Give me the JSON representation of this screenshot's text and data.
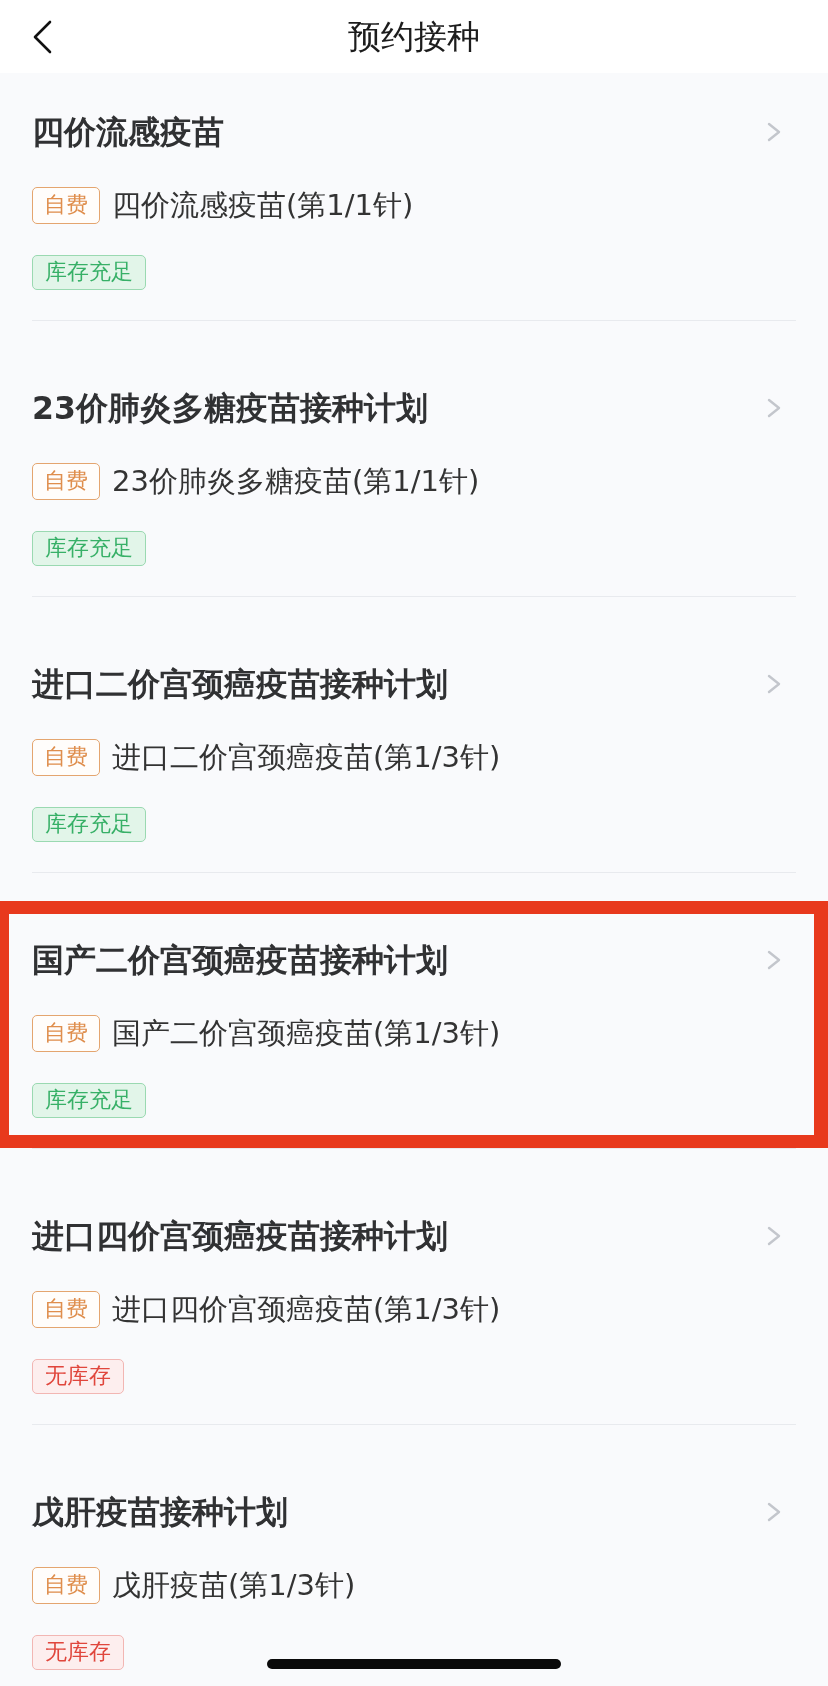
{
  "header": {
    "title": "预约接种"
  },
  "vaccines": [
    {
      "title": "四价流感疫苗",
      "fee_tag": "自费",
      "dose": "四价流感疫苗(第1/1针)",
      "stock": {
        "kind": "in_stock",
        "label": "库存充足"
      },
      "highlighted": false
    },
    {
      "title": "23价肺炎多糖疫苗接种计划",
      "fee_tag": "自费",
      "dose": "23价肺炎多糖疫苗(第1/1针)",
      "stock": {
        "kind": "in_stock",
        "label": "库存充足"
      },
      "highlighted": false
    },
    {
      "title": "进口二价宫颈癌疫苗接种计划",
      "fee_tag": "自费",
      "dose": "进口二价宫颈癌疫苗(第1/3针)",
      "stock": {
        "kind": "in_stock",
        "label": "库存充足"
      },
      "highlighted": false
    },
    {
      "title": "国产二价宫颈癌疫苗接种计划",
      "fee_tag": "自费",
      "dose": "国产二价宫颈癌疫苗(第1/3针)",
      "stock": {
        "kind": "in_stock",
        "label": "库存充足"
      },
      "highlighted": true
    },
    {
      "title": "进口四价宫颈癌疫苗接种计划",
      "fee_tag": "自费",
      "dose": "进口四价宫颈癌疫苗(第1/3针)",
      "stock": {
        "kind": "out_of_stock",
        "label": "无库存"
      },
      "highlighted": false
    },
    {
      "title": "戊肝疫苗接种计划",
      "fee_tag": "自费",
      "dose": "戊肝疫苗(第1/3针)",
      "stock": {
        "kind": "out_of_stock",
        "label": "无库存"
      },
      "highlighted": false
    }
  ]
}
